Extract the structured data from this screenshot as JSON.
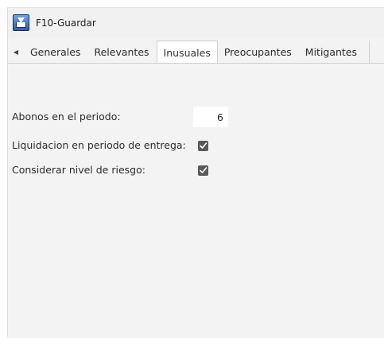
{
  "window": {
    "title": "F10-Guardar"
  },
  "tabs": [
    {
      "label": "Generales"
    },
    {
      "label": "Relevantes"
    },
    {
      "label": "Inusuales"
    },
    {
      "label": "Preocupantes"
    },
    {
      "label": "Mitigantes"
    }
  ],
  "active_tab": "Inusuales",
  "form": {
    "abonos_label": "Abonos en el periodo:",
    "abonos_value": "6",
    "liquidacion_label": "Liquidacion en periodo de entrega:",
    "liquidacion_checked": true,
    "riesgo_label": "Considerar nivel de riesgo:",
    "riesgo_checked": true
  },
  "icons": {
    "app": "save-download-icon",
    "tab_scroll": "caret-left-icon",
    "checkbox": "checked-checkbox-icon"
  }
}
